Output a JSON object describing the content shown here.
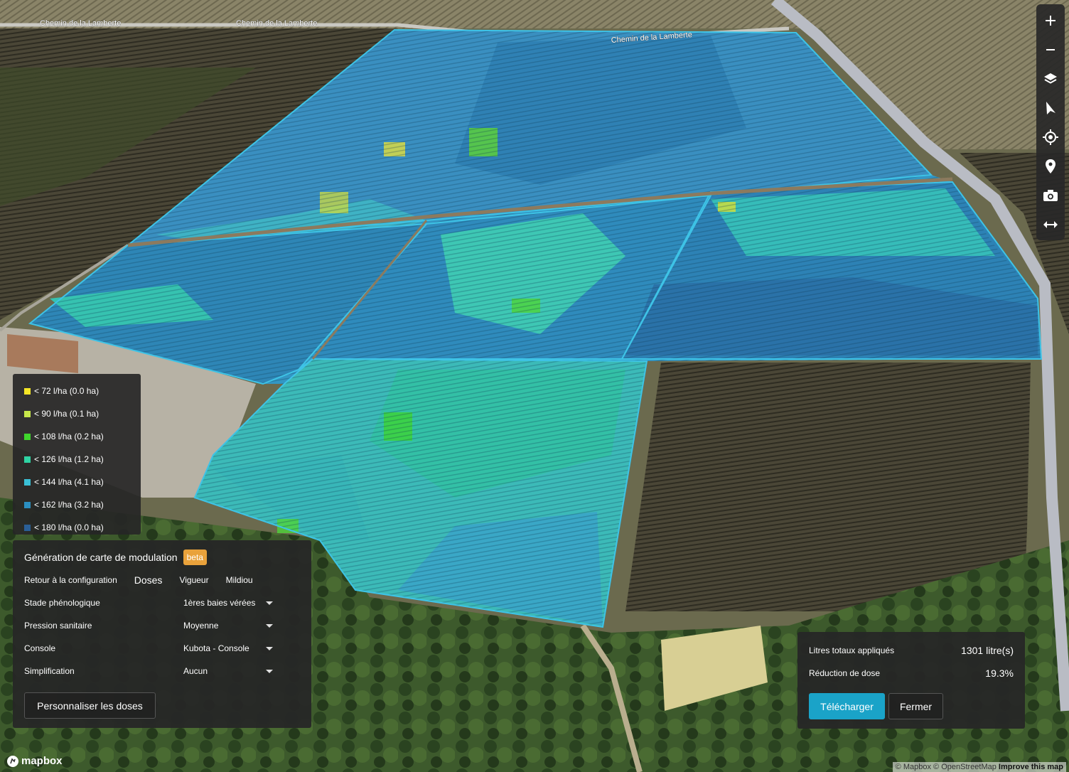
{
  "map": {
    "road_labels": [
      "Chemin de la Lamberte",
      "Chemin de la Lamberte",
      "Chemin de la Lamberte"
    ]
  },
  "controls": [
    {
      "name": "zoom-in-button",
      "icon": "plus-icon"
    },
    {
      "name": "zoom-out-button",
      "icon": "minus-icon"
    },
    {
      "name": "layers-button",
      "icon": "layers-icon"
    },
    {
      "name": "navigate-button",
      "icon": "navigation-arrow-icon"
    },
    {
      "name": "locate-button",
      "icon": "crosshair-icon"
    },
    {
      "name": "marker-button",
      "icon": "map-pin-icon"
    },
    {
      "name": "screenshot-button",
      "icon": "camera-icon"
    },
    {
      "name": "measure-button",
      "icon": "horizontal-arrows-icon"
    }
  ],
  "legend": {
    "items": [
      {
        "label": "< 72 l/ha (0.0 ha)",
        "color": "#f5e626"
      },
      {
        "label": "< 90 l/ha (0.1 ha)",
        "color": "#c8e84a"
      },
      {
        "label": "< 108 l/ha (0.2 ha)",
        "color": "#3fd62c"
      },
      {
        "label": "< 126 l/ha (1.2 ha)",
        "color": "#2fd3a3"
      },
      {
        "label": "< 144 l/ha (4.1 ha)",
        "color": "#3ac0d6"
      },
      {
        "label": "< 162 l/ha (3.2 ha)",
        "color": "#2b8fc0"
      },
      {
        "label": "< 180 l/ha (0.0 ha)",
        "color": "#2a5f96"
      }
    ]
  },
  "panel": {
    "title": "Génération de carte de modulation",
    "badge": "beta",
    "tabs": {
      "back": "Retour à la configuration",
      "doses": "Doses",
      "vigueur": "Vigueur",
      "mildiou": "Mildiou"
    },
    "fields": [
      {
        "label": "Stade phénologique",
        "value": "1ères baies vérées"
      },
      {
        "label": "Pression sanitaire",
        "value": "Moyenne"
      },
      {
        "label": "Console",
        "value": "Kubota - Console"
      },
      {
        "label": "Simplification",
        "value": "Aucun"
      }
    ],
    "custom_button": "Personnaliser les doses"
  },
  "summary": {
    "total_label": "Litres totaux appliqués",
    "total_value": "1301 litre(s)",
    "reduction_label": "Réduction de dose",
    "reduction_value": "19.3%",
    "download_button": "Télécharger",
    "close_button": "Fermer"
  },
  "attribution": {
    "logo": "mapbox",
    "mapbox": "© Mapbox",
    "osm": "© OpenStreetMap",
    "improve": "Improve this map"
  }
}
